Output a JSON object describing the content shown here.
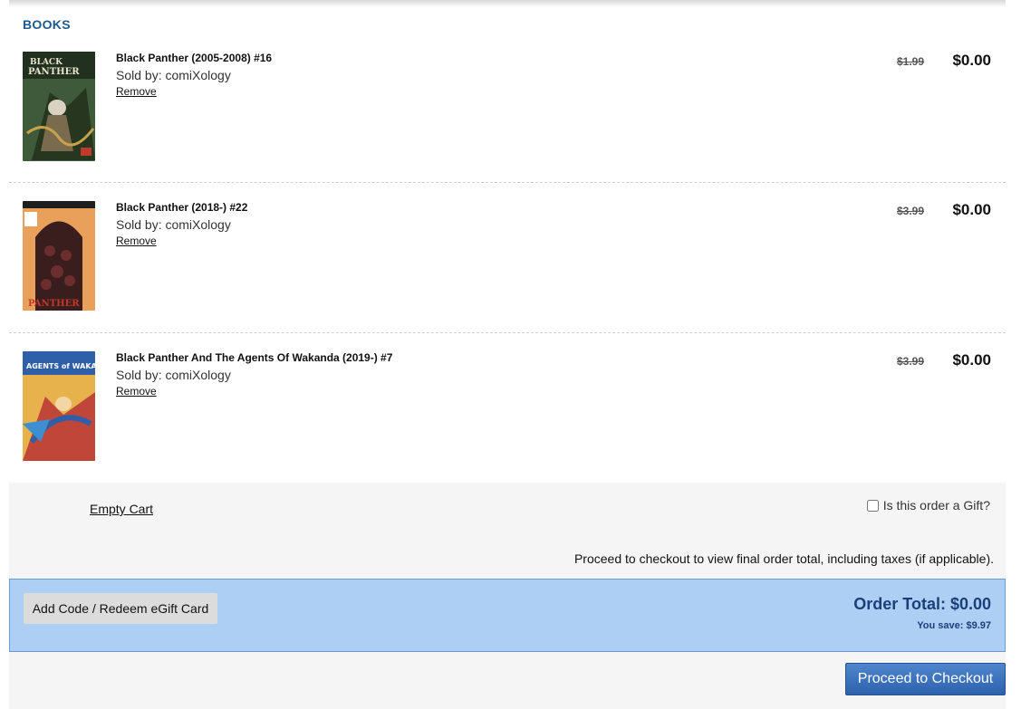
{
  "section": {
    "title": "BOOKS"
  },
  "items": [
    {
      "title": "Black Panther (2005-2008) #16",
      "seller": "Sold by: comiXology",
      "remove_label": "Remove",
      "old_price": "$1.99",
      "new_price": "$0.00",
      "cover_colors": {
        "bg": "#3f5a3a",
        "accent": "#c9a34a",
        "figure": "#d9d2c2"
      }
    },
    {
      "title": "Black Panther (2018-) #22",
      "seller": "Sold by: comiXology",
      "remove_label": "Remove",
      "old_price": "$3.99",
      "new_price": "$0.00",
      "cover_colors": {
        "bg": "#e8a05a",
        "accent": "#3a1e1e",
        "figure": "#c0392b"
      }
    },
    {
      "title": "Black Panther And The Agents Of Wakanda (2019-) #7",
      "seller": "Sold by: comiXology",
      "remove_label": "Remove",
      "old_price": "$3.99",
      "new_price": "$0.00",
      "cover_colors": {
        "bg": "#e7b24b",
        "accent": "#2f5fa8",
        "figure": "#c1463a"
      }
    }
  ],
  "cart": {
    "empty_label": "Empty Cart",
    "gift_label": "Is this order a Gift?",
    "gift_checked": false,
    "note": "Proceed to checkout to view final order total, including taxes (if applicable).",
    "code_button": "Add Code / Redeem eGift Card",
    "order_total": "Order Total: $0.00",
    "you_save": "You save: $9.97",
    "checkout_button": "Proceed to Checkout"
  },
  "colors": {
    "section_title": "#1d5a8c",
    "total_bar": "#aecff4",
    "total_text": "#1b3f7a",
    "checkout_button": "#3b72bd"
  }
}
